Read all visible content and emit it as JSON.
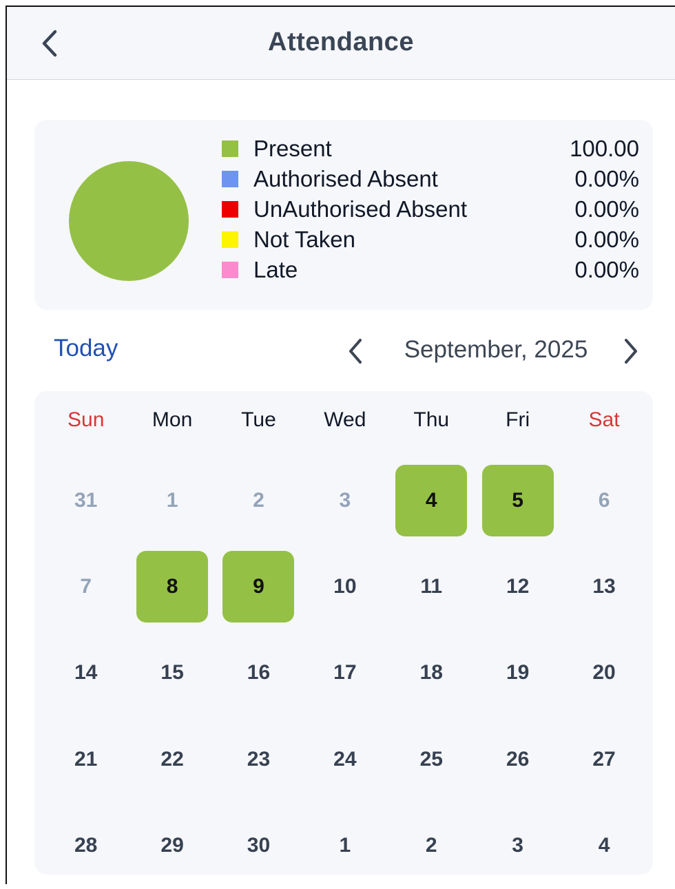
{
  "header": {
    "title": "Attendance",
    "back_icon": "chevron-left-icon"
  },
  "summary": {
    "pie": {
      "slices": [
        {
          "label": "Present",
          "value": 100.0,
          "color": "#95c046"
        },
        {
          "label": "Authorised Absent",
          "value": 0.0,
          "color": "#6d95f0"
        },
        {
          "label": "UnAuthorised Absent",
          "value": 0.0,
          "color": "#ee0000"
        },
        {
          "label": "Not Taken",
          "value": 0.0,
          "color": "#fdf400"
        },
        {
          "label": "Late",
          "value": 0.0,
          "color": "#f98ccc"
        }
      ]
    },
    "legend": [
      {
        "label": "Present",
        "value": "100.00",
        "color": "#95c046"
      },
      {
        "label": "Authorised Absent",
        "value": "0.00%",
        "color": "#6d95f0"
      },
      {
        "label": "UnAuthorised Absent",
        "value": "0.00%",
        "color": "#ee0000"
      },
      {
        "label": "Not Taken",
        "value": "0.00%",
        "color": "#fdf400"
      },
      {
        "label": "Late",
        "value": "0.00%",
        "color": "#f98ccc"
      }
    ]
  },
  "calendar_nav": {
    "today_label": "Today",
    "month_label": "September, 2025",
    "prev_icon": "chevron-left-icon",
    "next_icon": "chevron-right-icon"
  },
  "calendar": {
    "weekdays": [
      "Sun",
      "Mon",
      "Tue",
      "Wed",
      "Thu",
      "Fri",
      "Sat"
    ],
    "weekend_color": "#dc3535",
    "present_color": "#95c046",
    "weeks": [
      [
        {
          "d": "31",
          "muted": true
        },
        {
          "d": "1",
          "muted": true
        },
        {
          "d": "2",
          "muted": true
        },
        {
          "d": "3",
          "muted": true
        },
        {
          "d": "4",
          "present": true
        },
        {
          "d": "5",
          "present": true
        },
        {
          "d": "6",
          "muted": true
        }
      ],
      [
        {
          "d": "7",
          "muted": true
        },
        {
          "d": "8",
          "present": true
        },
        {
          "d": "9",
          "present": true
        },
        {
          "d": "10"
        },
        {
          "d": "11"
        },
        {
          "d": "12"
        },
        {
          "d": "13"
        }
      ],
      [
        {
          "d": "14"
        },
        {
          "d": "15"
        },
        {
          "d": "16"
        },
        {
          "d": "17"
        },
        {
          "d": "18"
        },
        {
          "d": "19"
        },
        {
          "d": "20"
        }
      ],
      [
        {
          "d": "21"
        },
        {
          "d": "22"
        },
        {
          "d": "23"
        },
        {
          "d": "24"
        },
        {
          "d": "25"
        },
        {
          "d": "26"
        },
        {
          "d": "27"
        }
      ],
      [
        {
          "d": "28"
        },
        {
          "d": "29"
        },
        {
          "d": "30"
        },
        {
          "d": "1"
        },
        {
          "d": "2"
        },
        {
          "d": "3"
        },
        {
          "d": "4"
        }
      ]
    ]
  }
}
